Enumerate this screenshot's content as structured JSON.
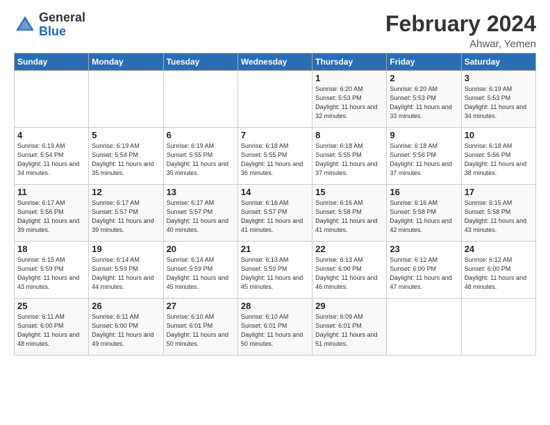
{
  "logo": {
    "line1": "General",
    "line2": "Blue"
  },
  "title": "February 2024",
  "location": "Ahwar, Yemen",
  "days_header": [
    "Sunday",
    "Monday",
    "Tuesday",
    "Wednesday",
    "Thursday",
    "Friday",
    "Saturday"
  ],
  "weeks": [
    [
      {
        "day": "",
        "sunrise": "",
        "sunset": "",
        "daylight": ""
      },
      {
        "day": "",
        "sunrise": "",
        "sunset": "",
        "daylight": ""
      },
      {
        "day": "",
        "sunrise": "",
        "sunset": "",
        "daylight": ""
      },
      {
        "day": "",
        "sunrise": "",
        "sunset": "",
        "daylight": ""
      },
      {
        "day": "1",
        "sunrise": "Sunrise: 6:20 AM",
        "sunset": "Sunset: 5:53 PM",
        "daylight": "Daylight: 11 hours and 32 minutes."
      },
      {
        "day": "2",
        "sunrise": "Sunrise: 6:20 AM",
        "sunset": "Sunset: 5:53 PM",
        "daylight": "Daylight: 11 hours and 33 minutes."
      },
      {
        "day": "3",
        "sunrise": "Sunrise: 6:19 AM",
        "sunset": "Sunset: 5:53 PM",
        "daylight": "Daylight: 11 hours and 34 minutes."
      }
    ],
    [
      {
        "day": "4",
        "sunrise": "Sunrise: 6:19 AM",
        "sunset": "Sunset: 5:54 PM",
        "daylight": "Daylight: 11 hours and 34 minutes."
      },
      {
        "day": "5",
        "sunrise": "Sunrise: 6:19 AM",
        "sunset": "Sunset: 5:54 PM",
        "daylight": "Daylight: 11 hours and 35 minutes."
      },
      {
        "day": "6",
        "sunrise": "Sunrise: 6:19 AM",
        "sunset": "Sunset: 5:55 PM",
        "daylight": "Daylight: 11 hours and 35 minutes."
      },
      {
        "day": "7",
        "sunrise": "Sunrise: 6:18 AM",
        "sunset": "Sunset: 5:55 PM",
        "daylight": "Daylight: 11 hours and 36 minutes."
      },
      {
        "day": "8",
        "sunrise": "Sunrise: 6:18 AM",
        "sunset": "Sunset: 5:55 PM",
        "daylight": "Daylight: 11 hours and 37 minutes."
      },
      {
        "day": "9",
        "sunrise": "Sunrise: 6:18 AM",
        "sunset": "Sunset: 5:56 PM",
        "daylight": "Daylight: 11 hours and 37 minutes."
      },
      {
        "day": "10",
        "sunrise": "Sunrise: 6:18 AM",
        "sunset": "Sunset: 5:56 PM",
        "daylight": "Daylight: 11 hours and 38 minutes."
      }
    ],
    [
      {
        "day": "11",
        "sunrise": "Sunrise: 6:17 AM",
        "sunset": "Sunset: 5:56 PM",
        "daylight": "Daylight: 11 hours and 39 minutes."
      },
      {
        "day": "12",
        "sunrise": "Sunrise: 6:17 AM",
        "sunset": "Sunset: 5:57 PM",
        "daylight": "Daylight: 11 hours and 39 minutes."
      },
      {
        "day": "13",
        "sunrise": "Sunrise: 6:17 AM",
        "sunset": "Sunset: 5:57 PM",
        "daylight": "Daylight: 11 hours and 40 minutes."
      },
      {
        "day": "14",
        "sunrise": "Sunrise: 6:16 AM",
        "sunset": "Sunset: 5:57 PM",
        "daylight": "Daylight: 11 hours and 41 minutes."
      },
      {
        "day": "15",
        "sunrise": "Sunrise: 6:16 AM",
        "sunset": "Sunset: 5:58 PM",
        "daylight": "Daylight: 11 hours and 41 minutes."
      },
      {
        "day": "16",
        "sunrise": "Sunrise: 6:16 AM",
        "sunset": "Sunset: 5:58 PM",
        "daylight": "Daylight: 11 hours and 42 minutes."
      },
      {
        "day": "17",
        "sunrise": "Sunrise: 6:15 AM",
        "sunset": "Sunset: 5:58 PM",
        "daylight": "Daylight: 11 hours and 43 minutes."
      }
    ],
    [
      {
        "day": "18",
        "sunrise": "Sunrise: 6:15 AM",
        "sunset": "Sunset: 5:59 PM",
        "daylight": "Daylight: 11 hours and 43 minutes."
      },
      {
        "day": "19",
        "sunrise": "Sunrise: 6:14 AM",
        "sunset": "Sunset: 5:59 PM",
        "daylight": "Daylight: 11 hours and 44 minutes."
      },
      {
        "day": "20",
        "sunrise": "Sunrise: 6:14 AM",
        "sunset": "Sunset: 5:59 PM",
        "daylight": "Daylight: 11 hours and 45 minutes."
      },
      {
        "day": "21",
        "sunrise": "Sunrise: 6:13 AM",
        "sunset": "Sunset: 5:59 PM",
        "daylight": "Daylight: 11 hours and 45 minutes."
      },
      {
        "day": "22",
        "sunrise": "Sunrise: 6:13 AM",
        "sunset": "Sunset: 6:00 PM",
        "daylight": "Daylight: 11 hours and 46 minutes."
      },
      {
        "day": "23",
        "sunrise": "Sunrise: 6:12 AM",
        "sunset": "Sunset: 6:00 PM",
        "daylight": "Daylight: 11 hours and 47 minutes."
      },
      {
        "day": "24",
        "sunrise": "Sunrise: 6:12 AM",
        "sunset": "Sunset: 6:00 PM",
        "daylight": "Daylight: 11 hours and 48 minutes."
      }
    ],
    [
      {
        "day": "25",
        "sunrise": "Sunrise: 6:11 AM",
        "sunset": "Sunset: 6:00 PM",
        "daylight": "Daylight: 11 hours and 48 minutes."
      },
      {
        "day": "26",
        "sunrise": "Sunrise: 6:11 AM",
        "sunset": "Sunset: 6:00 PM",
        "daylight": "Daylight: 11 hours and 49 minutes."
      },
      {
        "day": "27",
        "sunrise": "Sunrise: 6:10 AM",
        "sunset": "Sunset: 6:01 PM",
        "daylight": "Daylight: 11 hours and 50 minutes."
      },
      {
        "day": "28",
        "sunrise": "Sunrise: 6:10 AM",
        "sunset": "Sunset: 6:01 PM",
        "daylight": "Daylight: 11 hours and 50 minutes."
      },
      {
        "day": "29",
        "sunrise": "Sunrise: 6:09 AM",
        "sunset": "Sunset: 6:01 PM",
        "daylight": "Daylight: 11 hours and 51 minutes."
      },
      {
        "day": "",
        "sunrise": "",
        "sunset": "",
        "daylight": ""
      },
      {
        "day": "",
        "sunrise": "",
        "sunset": "",
        "daylight": ""
      }
    ]
  ]
}
